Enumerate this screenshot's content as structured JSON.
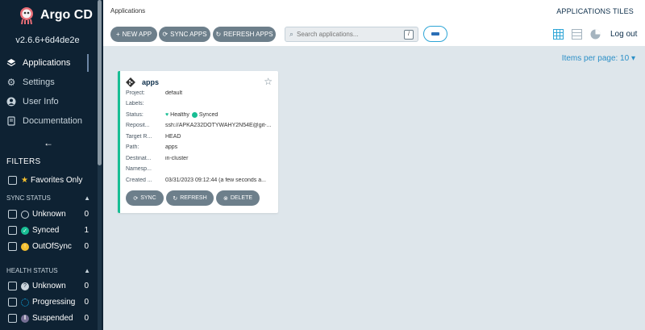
{
  "sidebar": {
    "brand": "Argo CD",
    "version": "v2.6.6+6d4de2e",
    "nav": [
      {
        "label": "Applications",
        "icon": "layers-icon"
      },
      {
        "label": "Settings",
        "icon": "gears-icon"
      },
      {
        "label": "User Info",
        "icon": "user-icon"
      },
      {
        "label": "Documentation",
        "icon": "book-icon"
      }
    ],
    "filters_title": "FILTERS",
    "favorites_label": "Favorites Only",
    "sync_status": {
      "title": "SYNC STATUS",
      "items": [
        {
          "label": "Unknown",
          "count": "0",
          "color": "#ccd6dd"
        },
        {
          "label": "Synced",
          "count": "1",
          "color": "#18be94"
        },
        {
          "label": "OutOfSync",
          "count": "0",
          "color": "#f4c030"
        }
      ]
    },
    "health_status": {
      "title": "HEALTH STATUS",
      "items": [
        {
          "label": "Unknown",
          "count": "0",
          "color": "#ccd6dd"
        },
        {
          "label": "Progressing",
          "count": "0",
          "color": "#0dadea"
        },
        {
          "label": "Suspended",
          "count": "0",
          "color": "#766f94"
        }
      ]
    }
  },
  "topbar": {
    "breadcrumb": "Applications",
    "view_title": "APPLICATIONS TILES",
    "new_app": "NEW APP",
    "sync_apps": "SYNC APPS",
    "refresh_apps": "REFRESH APPS",
    "search_placeholder": "Search applications...",
    "search_key": "/",
    "logout": "Log out"
  },
  "pagination": {
    "items_per_page": "Items per page: 10"
  },
  "app_card": {
    "name": "apps",
    "fields": [
      {
        "label": "Project:",
        "value": "default"
      },
      {
        "label": "Labels:",
        "value": ""
      },
      {
        "label": "Status:",
        "value": ""
      },
      {
        "label": "Reposit...",
        "value": "ssh://APKA232DOTYWAHY2N54E@git-..."
      },
      {
        "label": "Target R...",
        "value": "HEAD"
      },
      {
        "label": "Path:",
        "value": "apps"
      },
      {
        "label": "Destinat...",
        "value": "in-cluster"
      },
      {
        "label": "Namesp...",
        "value": ""
      },
      {
        "label": "Created ...",
        "value": "03/31/2023 09:12:44  (a few seconds a..."
      }
    ],
    "health": "Healthy",
    "sync": "Synced",
    "buttons": {
      "sync": "SYNC",
      "refresh": "REFRESH",
      "delete": "DELETE"
    },
    "accent_color": "#18be94"
  }
}
